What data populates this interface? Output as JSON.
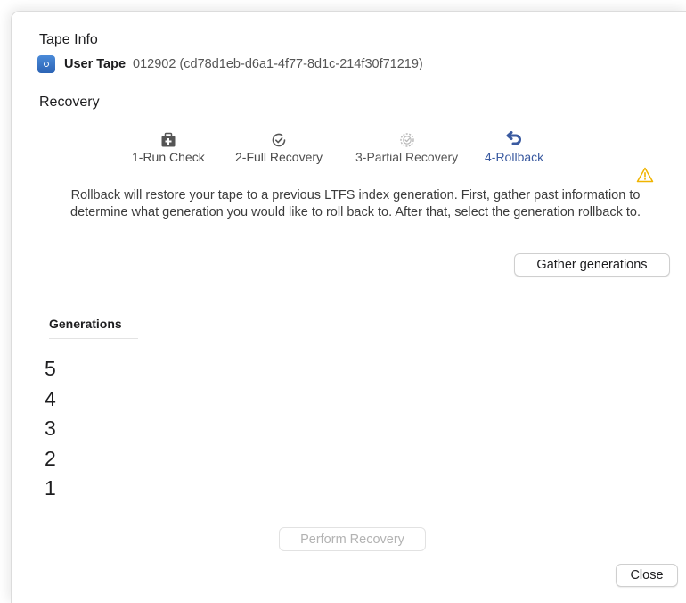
{
  "tape_info": {
    "title": "Tape Info",
    "tape_type": "User Tape",
    "tape_identifier": "012902 (cd78d1eb-d6a1-4f77-8d1c-214f30f71219)",
    "tape_icon": "tape-cartridge-icon"
  },
  "recovery": {
    "title": "Recovery",
    "steps": [
      {
        "label": "1-Run Check",
        "icon": "first-aid-kit-icon",
        "state": "enabled"
      },
      {
        "label": "2-Full Recovery",
        "icon": "checkmark-circle-icon",
        "state": "enabled"
      },
      {
        "label": "3-Partial Recovery",
        "icon": "checkmark-circle-dashed-icon",
        "state": "disabled"
      },
      {
        "label": "4-Rollback",
        "icon": "rollback-arrow-icon",
        "state": "active"
      }
    ],
    "warning_icon": "warning-triangle-icon",
    "description": "Rollback will restore your tape to a previous LTFS index generation. First, gather past information to determine what generation you would like to roll back to. After that, select the generation rollback to.",
    "gather_button": "Gather generations"
  },
  "generations": {
    "header": "Generations",
    "items": [
      "5",
      "4",
      "3",
      "2",
      "1"
    ]
  },
  "perform_button": "Perform Recovery",
  "close_button": "Close",
  "colors": {
    "accent": "#3a5aa0",
    "warning": "#f0b400",
    "tape_icon": "#3a78c8"
  }
}
